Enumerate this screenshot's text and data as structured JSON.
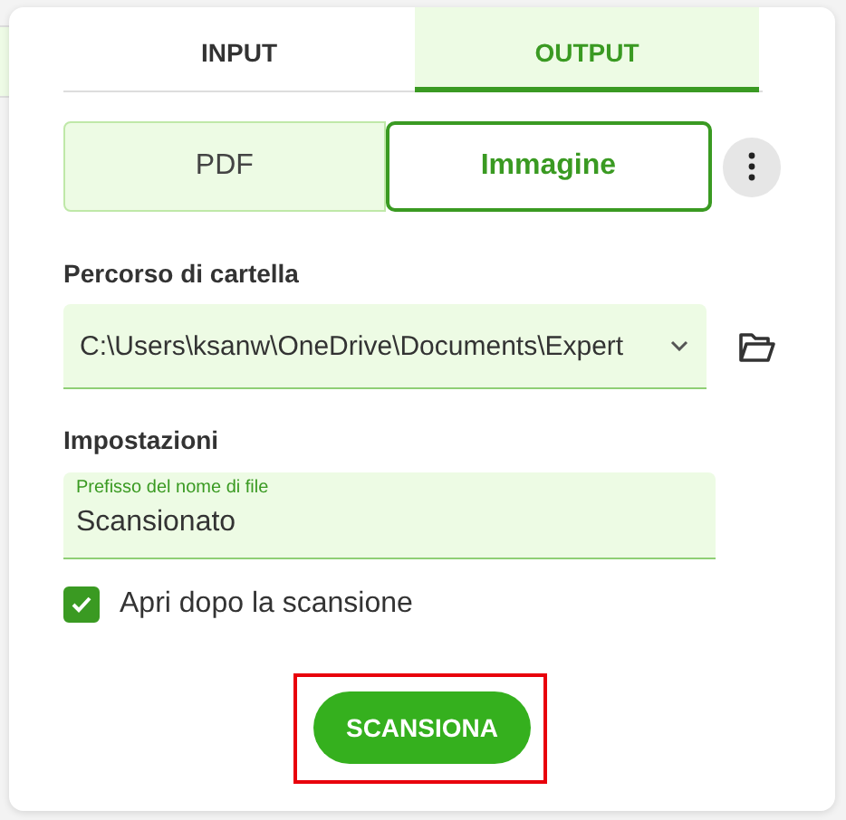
{
  "tabs": [
    {
      "label": "INPUT",
      "selected": false
    },
    {
      "label": "OUTPUT",
      "selected": true
    }
  ],
  "formats": [
    {
      "label": "PDF",
      "selected": false
    },
    {
      "label": "Immagine",
      "selected": true
    }
  ],
  "folder": {
    "label": "Percorso di cartella",
    "value": "C:\\Users\\ksanw\\OneDrive\\Documents\\Expert"
  },
  "settings": {
    "label": "Impostazioni",
    "field_label": "Prefisso del nome di file",
    "value": "Scansionato"
  },
  "open_after": {
    "label": "Apri dopo la scansione",
    "checked": true
  },
  "scan_button": {
    "label": "SCANSIONA",
    "highlighted": true
  }
}
